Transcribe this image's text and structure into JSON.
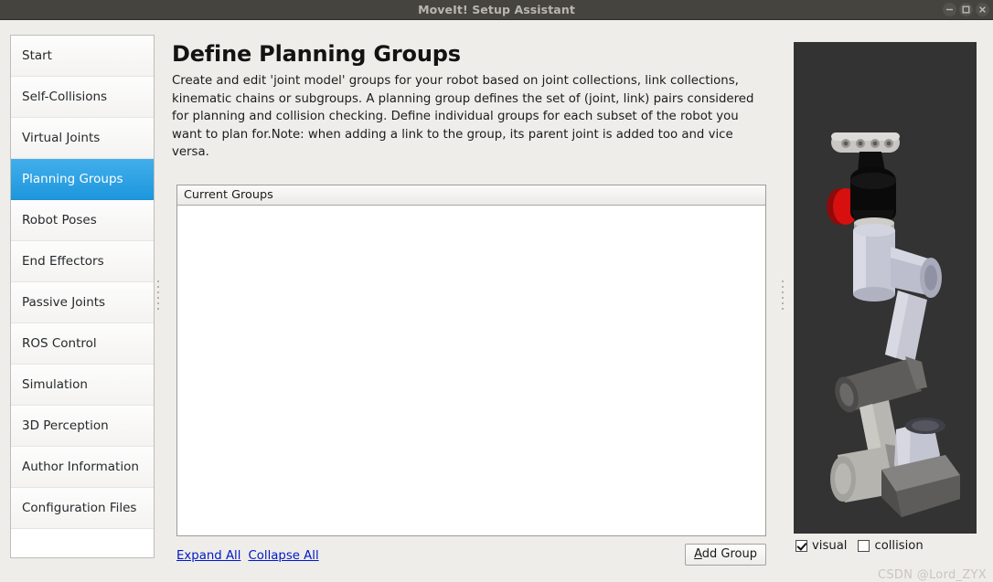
{
  "window": {
    "title": "MoveIt! Setup Assistant",
    "controls": [
      {
        "name": "minimize",
        "glyph": "minus"
      },
      {
        "name": "maximize",
        "glyph": "square"
      },
      {
        "name": "close",
        "glyph": "cross"
      }
    ]
  },
  "sidebar": {
    "items": [
      {
        "label": "Start",
        "selected": false
      },
      {
        "label": "Self-Collisions",
        "selected": false
      },
      {
        "label": "Virtual Joints",
        "selected": false
      },
      {
        "label": "Planning Groups",
        "selected": true
      },
      {
        "label": "Robot Poses",
        "selected": false
      },
      {
        "label": "End Effectors",
        "selected": false
      },
      {
        "label": "Passive Joints",
        "selected": false
      },
      {
        "label": "ROS Control",
        "selected": false
      },
      {
        "label": "Simulation",
        "selected": false
      },
      {
        "label": "3D Perception",
        "selected": false
      },
      {
        "label": "Author Information",
        "selected": false
      },
      {
        "label": "Configuration Files",
        "selected": false
      }
    ]
  },
  "main": {
    "title": "Define Planning Groups",
    "description": "Create and edit 'joint model' groups for your robot based on joint collections, link collections, kinematic chains or subgroups. A planning group defines the set of (joint, link) pairs considered for planning and collision checking. Define individual groups for each subset of the robot you want to plan for.Note: when adding a link to the group, its parent joint is added too and vice versa.",
    "groups_panel": {
      "header": "Current Groups",
      "rows": []
    },
    "expand_all": "Expand All",
    "collapse_all": "Collapse All",
    "add_group_mnemonic": "A",
    "add_group_rest": "dd Group"
  },
  "viewer": {
    "visual_label": "visual",
    "visual_checked": true,
    "collision_label": "collision",
    "collision_checked": false,
    "background_color": "#333333"
  },
  "watermark": "CSDN @Lord_ZYX",
  "colors": {
    "titlebar": "#45443f",
    "window_background": "#efedea",
    "selection_blue": "#1d97dd",
    "link_blue": "#0018c8"
  }
}
